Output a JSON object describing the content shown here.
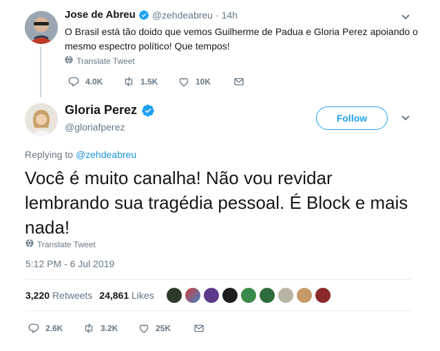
{
  "parent_tweet": {
    "display_name": "Jose de Abreu",
    "handle": "@zehdeabreu",
    "time_sep": "·",
    "age": "14h",
    "text": "O Brasil está tão doido que vemos Guilherme de Padua e Gloria Perez apoiando o mesmo espectro político! Que tempos!",
    "translate": "Translate Tweet",
    "replies": "4.0K",
    "retweets": "1.5K",
    "likes": "10K"
  },
  "main_tweet": {
    "display_name": "Gloria Perez",
    "handle": "@gloriafperez",
    "follow_label": "Follow",
    "replying_prefix": "Replying to",
    "replying_handle": "@zehdeabreu",
    "text": "Você é muito canalha! Não vou revidar lembrando sua tragédia pessoal. É Block e mais nada!",
    "translate": "Translate Tweet",
    "timestamp": "5:12 PM - 6 Jul 2019",
    "retweet_count": "3,220",
    "retweet_label": "Retweets",
    "like_count": "24,861",
    "like_label": "Likes",
    "replies": "2.6K",
    "retweets": "3.2K",
    "likes": "25K"
  },
  "colors": {
    "accent": "#1da1f2",
    "verified": "#1da1f2",
    "muted": "#657786",
    "thread_line": "#ccd6dd"
  }
}
